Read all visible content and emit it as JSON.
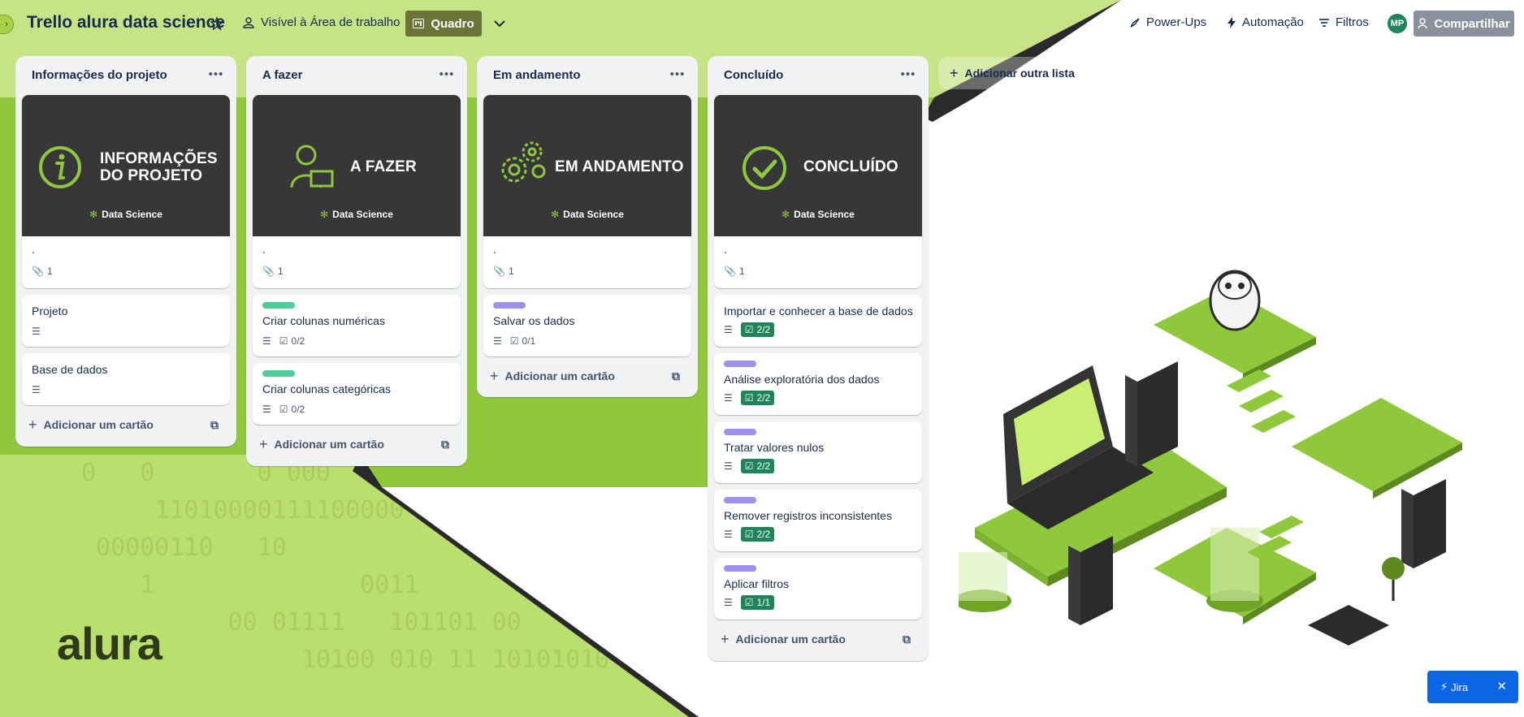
{
  "topbar": {
    "board_title": "Trello alura data science",
    "visibility_label": "Visível à Área de trabalho",
    "view_label": "Quadro",
    "powerups_label": "Power-Ups",
    "automation_label": "Automação",
    "filters_label": "Filtros",
    "avatar_initials": "MP",
    "share_label": "Compartilhar"
  },
  "lists": [
    {
      "title": "Informações do projeto",
      "cover": {
        "heading_line1": "INFORMAÇÕES",
        "heading_line2": "DO PROJETO",
        "brand": "Data Science"
      },
      "cover_card": {
        "title": ".",
        "attachments": "1"
      },
      "cards": [
        {
          "title": "Projeto"
        },
        {
          "title": "Base de dados"
        }
      ],
      "add_card_label": "Adicionar um cartão"
    },
    {
      "title": "A fazer",
      "cover": {
        "heading_line1": "A FAZER",
        "brand": "Data Science"
      },
      "cover_card": {
        "title": ".",
        "attachments": "1"
      },
      "cards": [
        {
          "title": "Criar colunas numéricas",
          "checklist": "0/2",
          "label_color": "#4bce97"
        },
        {
          "title": "Criar colunas categóricas",
          "checklist": "0/2",
          "label_color": "#4bce97"
        }
      ],
      "add_card_label": "Adicionar um cartão"
    },
    {
      "title": "Em andamento",
      "cover": {
        "heading_line1": "EM ANDAMENTO",
        "brand": "Data Science"
      },
      "cover_card": {
        "title": ".",
        "attachments": "1"
      },
      "cards": [
        {
          "title": "Salvar os dados",
          "checklist": "0/1",
          "label_color": "#9f8fef"
        }
      ],
      "add_card_label": "Adicionar um cartão"
    },
    {
      "title": "Concluído",
      "cover": {
        "heading_line1": "CONCLUÍDO",
        "brand": "Data Science"
      },
      "cover_card": {
        "title": ".",
        "attachments": "1"
      },
      "cards": [
        {
          "title": "Importar e conhecer a base de dados",
          "checklist": "2/2"
        },
        {
          "title": "Análise exploratória dos dados",
          "checklist": "2/2",
          "label_color": "#9f8fef"
        },
        {
          "title": "Tratar valores nulos",
          "checklist": "2/2",
          "label_color": "#9f8fef"
        },
        {
          "title": "Remover registros inconsistentes",
          "checklist": "2/2",
          "label_color": "#9f8fef"
        },
        {
          "title": "Aplicar filtros",
          "checklist": "1/1",
          "label_color": "#9f8fef"
        }
      ],
      "add_card_label": "Adicionar um cartão"
    }
  ],
  "add_list_label": "Adicionar outra lista",
  "background": {
    "logo": "alura",
    "accent": "#8fc83a"
  },
  "jira_widget": {
    "label": "Jira"
  },
  "colors": {
    "cover_dark": "#373739",
    "icon_green": "#8fc83a",
    "done_badge": "#1f845a",
    "label_green": "#4bce97",
    "label_purple": "#9f8fef"
  }
}
